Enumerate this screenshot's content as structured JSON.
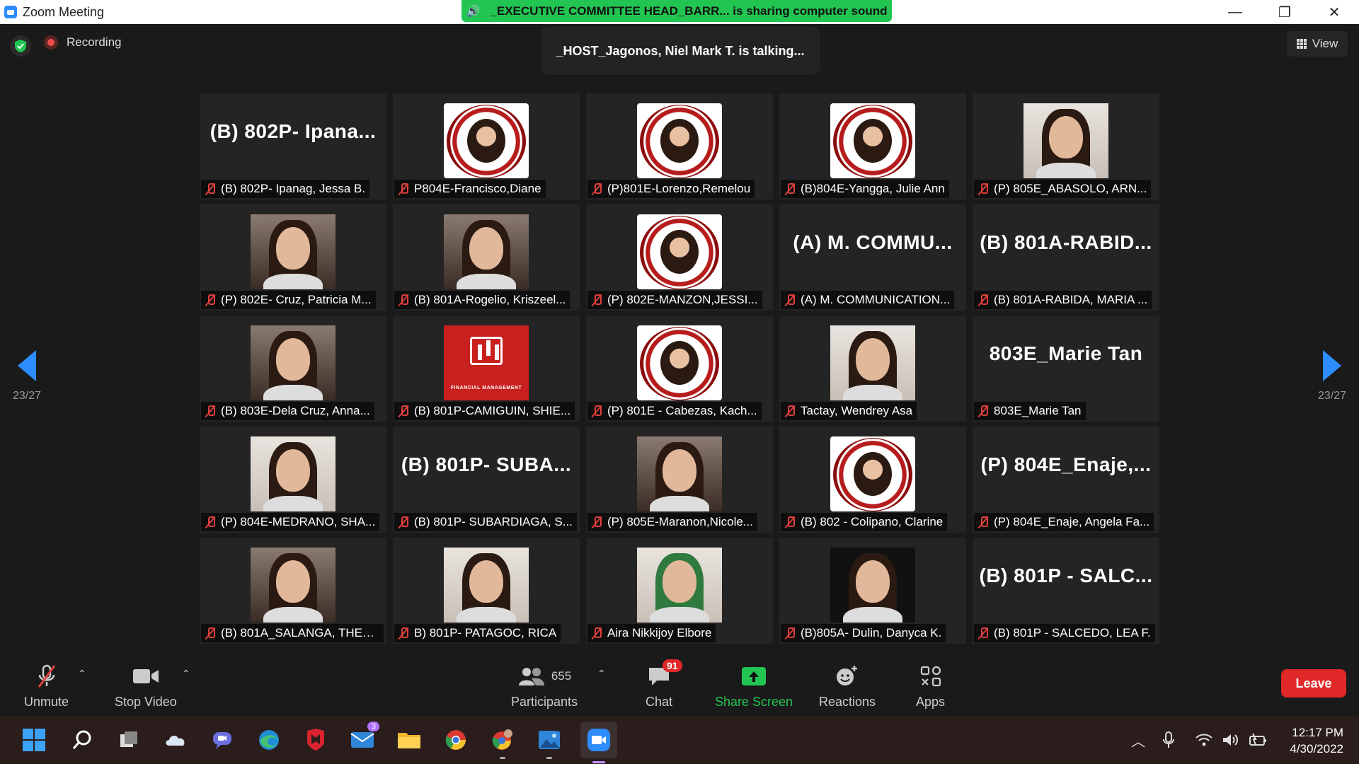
{
  "window": {
    "title": "Zoom Meeting",
    "share_banner": "_EXECUTIVE COMMITTEE HEAD_BARR... is sharing computer sound",
    "controls": [
      "—",
      "❐",
      "✕"
    ]
  },
  "top": {
    "recording_label": "Recording",
    "talking": "_HOST_Jagonos, Niel Mark T. is talking...",
    "view_label": "View"
  },
  "pager": {
    "left": "23/27",
    "right": "23/27"
  },
  "tiles": [
    {
      "kind": "text",
      "big": "(B) 802P- Ipana...",
      "name": "(B) 802P- Ipanag, Jessa B."
    },
    {
      "kind": "badge",
      "name": "P804E-Francisco,Diane"
    },
    {
      "kind": "badge",
      "name": "(P)801E-Lorenzo,Remelou"
    },
    {
      "kind": "badge",
      "name": "(B)804E-Yangga, Julie Ann"
    },
    {
      "kind": "light",
      "name": "(P) 805E_ABASOLO, ARN..."
    },
    {
      "kind": "pic",
      "name": "(P) 802E- Cruz, Patricia M..."
    },
    {
      "kind": "pic",
      "name": "(B) 801A-Rogelio, Kriszeel..."
    },
    {
      "kind": "badge",
      "name": "(P) 802E-MANZON,JESSI..."
    },
    {
      "kind": "text",
      "big": "(A) M. COMMU...",
      "name": "(A) M. COMMUNICATION..."
    },
    {
      "kind": "text",
      "big": "(B) 801A-RABID...",
      "name": "(B) 801A-RABIDA, MARIA ..."
    },
    {
      "kind": "pic",
      "name": "(B) 803E-Dela Cruz, Anna..."
    },
    {
      "kind": "red",
      "caption": "FINANCIAL MANAGEMENT",
      "name": "(B) 801P-CAMIGUIN, SHIE..."
    },
    {
      "kind": "badge",
      "name": "(P) 801E - Cabezas, Kach..."
    },
    {
      "kind": "light",
      "name": "Tactay, Wendrey Asa"
    },
    {
      "kind": "text",
      "big": "803E_Marie Tan",
      "name": "803E_Marie Tan"
    },
    {
      "kind": "light",
      "name": "(P) 804E-MEDRANO, SHA..."
    },
    {
      "kind": "text",
      "big": "(B) 801P- SUBA...",
      "name": "(B) 801P- SUBARDIAGA, S..."
    },
    {
      "kind": "pic",
      "name": "(P) 805E-Maranon,Nicole..."
    },
    {
      "kind": "badge",
      "name": "(B) 802 - Colipano, Clarine"
    },
    {
      "kind": "text",
      "big": "(P) 804E_Enaje,...",
      "name": "(P) 804E_Enaje, Angela Fa..."
    },
    {
      "kind": "pic",
      "name": "(B) 801A_SALANGA, THER..."
    },
    {
      "kind": "light",
      "name": "B) 801P- PATAGOC, RICA"
    },
    {
      "kind": "green",
      "name": "Aira Nikkijoy Elbore"
    },
    {
      "kind": "dark",
      "name": "(B)805A- Dulin, Danyca K."
    },
    {
      "kind": "text",
      "big": "(B) 801P - SALC...",
      "name": "(B) 801P - SALCEDO, LEA F."
    }
  ],
  "toolbar": {
    "unmute": "Unmute",
    "stop_video": "Stop Video",
    "participants_count": "655",
    "participants": "Participants",
    "chat": "Chat",
    "chat_badge": "91",
    "share_screen": "Share Screen",
    "reactions": "Reactions",
    "apps": "Apps",
    "leave": "Leave"
  },
  "taskbar": {
    "mail_badge": "3",
    "time": "12:17 PM",
    "date": "4/30/2022"
  },
  "colors": {
    "accent": "#2d8cff",
    "share_green": "#23c552",
    "leave_red": "#e02828",
    "muted_red": "#e0403c"
  }
}
